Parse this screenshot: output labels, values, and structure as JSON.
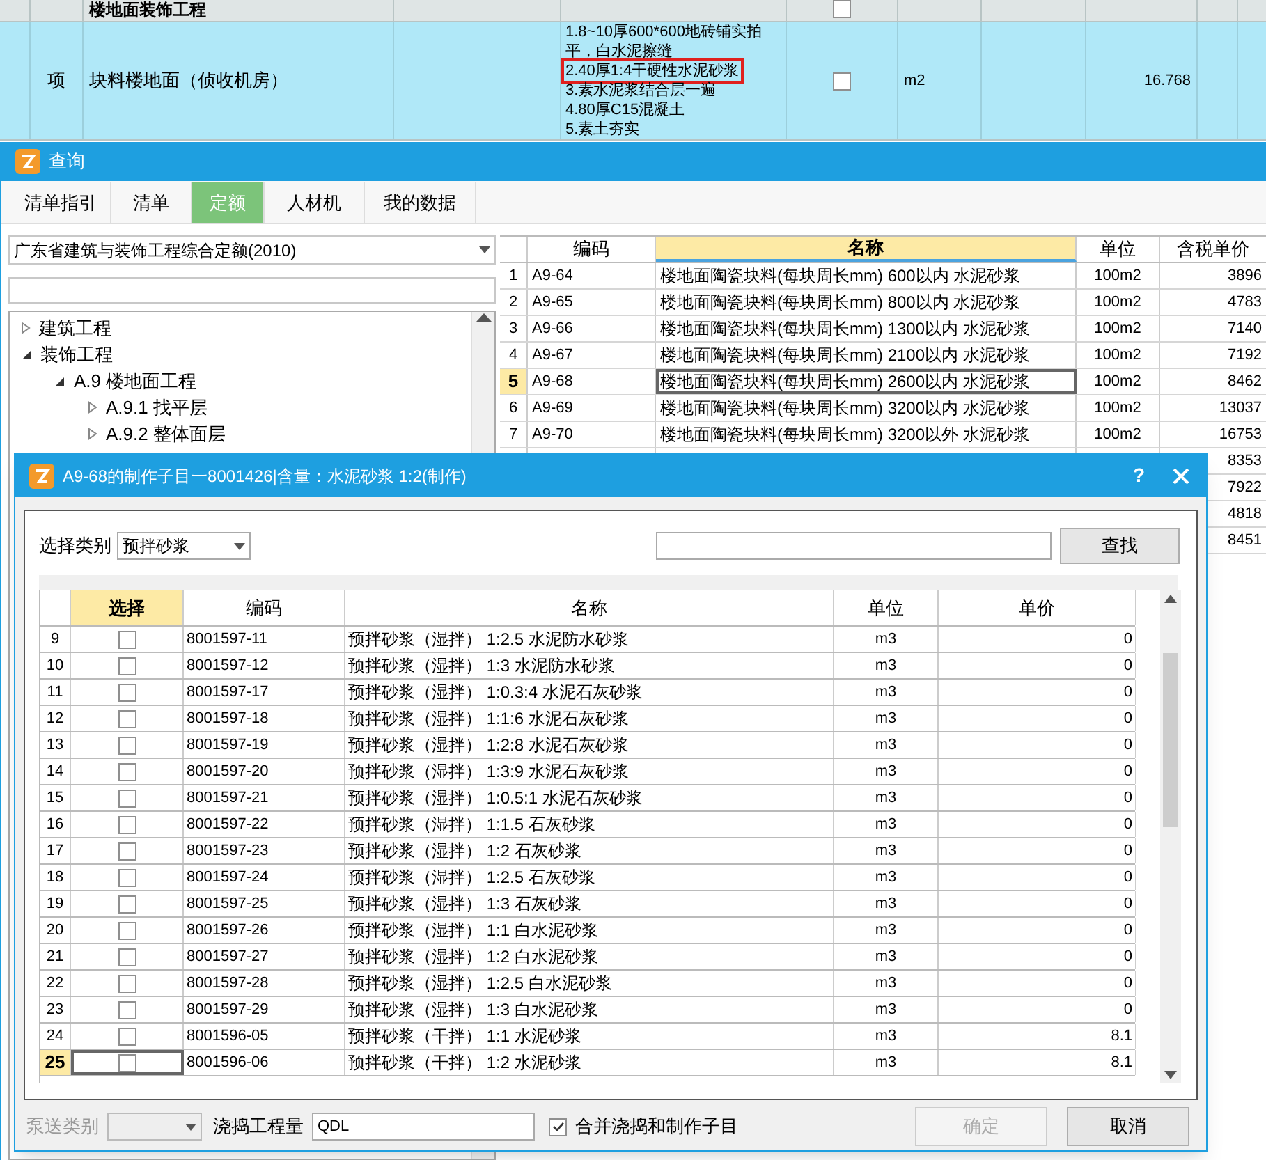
{
  "sheet": {
    "group_row": {
      "name": "楼地面装饰工程",
      "checked": false
    },
    "item_row": {
      "type": "项",
      "name": "块料楼地面（侦收机房）",
      "selected": true,
      "checked": false,
      "unit": "m2",
      "quantity": "16.768",
      "description_lines": [
        {
          "text": "1.8~10厚600*600地砖铺实拍",
          "highlighted": false
        },
        {
          "text": "平，白水泥擦缝",
          "highlighted": false
        },
        {
          "text": "2.40厚1:4干硬性水泥砂浆",
          "highlighted": true
        },
        {
          "text": "3.素水泥浆结合层一遍",
          "highlighted": false
        },
        {
          "text": "4.80厚C15混凝土",
          "highlighted": false
        },
        {
          "text": "5.素土夯实",
          "highlighted": false
        }
      ]
    }
  },
  "query_window": {
    "title": "查询",
    "tabs": [
      {
        "label": "清单指引",
        "selected": false
      },
      {
        "label": "清单",
        "selected": false
      },
      {
        "label": "定额",
        "selected": true
      },
      {
        "label": "人材机",
        "selected": false
      },
      {
        "label": "我的数据",
        "selected": false
      }
    ],
    "library_select": "广东省建筑与装饰工程综合定额(2010)",
    "tree": [
      {
        "label": "建筑工程",
        "expanded": false
      },
      {
        "label": "装饰工程",
        "expanded": true,
        "children": [
          {
            "label": "A.9 楼地面工程",
            "expanded": true,
            "children": [
              {
                "label": "A.9.1 找平层",
                "expanded": false
              },
              {
                "label": "A.9.2 整体面层",
                "expanded": false
              }
            ]
          }
        ]
      }
    ],
    "table": {
      "columns": [
        {
          "label": "编码",
          "selected": false
        },
        {
          "label": "名称",
          "selected": true
        },
        {
          "label": "单位",
          "selected": false
        },
        {
          "label": "含税单价",
          "selected": false
        }
      ],
      "rows": [
        {
          "index": "1",
          "code": "A9-64",
          "name": "楼地面陶瓷块料(每块周长mm) 600以内  水泥砂浆",
          "unit": "100m2",
          "price": "3896",
          "selected": false
        },
        {
          "index": "2",
          "code": "A9-65",
          "name": "楼地面陶瓷块料(每块周长mm) 800以内  水泥砂浆",
          "unit": "100m2",
          "price": "4783",
          "selected": false
        },
        {
          "index": "3",
          "code": "A9-66",
          "name": "楼地面陶瓷块料(每块周长mm) 1300以内  水泥砂浆",
          "unit": "100m2",
          "price": "7140",
          "selected": false
        },
        {
          "index": "4",
          "code": "A9-67",
          "name": "楼地面陶瓷块料(每块周长mm) 2100以内  水泥砂浆",
          "unit": "100m2",
          "price": "7192",
          "selected": false
        },
        {
          "index": "5",
          "code": "A9-68",
          "name": "楼地面陶瓷块料(每块周长mm) 2600以内  水泥砂浆",
          "unit": "100m2",
          "price": "8462",
          "selected": true
        },
        {
          "index": "6",
          "code": "A9-69",
          "name": "楼地面陶瓷块料(每块周长mm) 3200以内  水泥砂浆",
          "unit": "100m2",
          "price": "13037",
          "selected": false
        },
        {
          "index": "7",
          "code": "A9-70",
          "name": "楼地面陶瓷块料(每块周长mm) 3200以外  水泥砂浆",
          "unit": "100m2",
          "price": "16753",
          "selected": false
        },
        {
          "price": "8353"
        },
        {
          "price": "7922"
        },
        {
          "price": "4818"
        },
        {
          "price": "8451"
        }
      ]
    }
  },
  "dialog": {
    "title": "A9-68的制作子目一8001426|含量：水泥砂浆 1:2(制作)",
    "help_button": "?",
    "category": {
      "label": "选择类别",
      "value": "预拌砂浆"
    },
    "find_button": "查找",
    "table": {
      "columns": [
        {
          "label": "选择",
          "selected": true
        },
        {
          "label": "编码",
          "selected": false
        },
        {
          "label": "名称",
          "selected": false
        },
        {
          "label": "单位",
          "selected": false
        },
        {
          "label": "单价",
          "selected": false
        }
      ],
      "rows": [
        {
          "index": "9",
          "checked": false,
          "code": "8001597-11",
          "name": "预拌砂浆（湿拌） 1:2.5 水泥防水砂浆",
          "unit": "m3",
          "price": "0",
          "selected": false
        },
        {
          "index": "10",
          "checked": false,
          "code": "8001597-12",
          "name": "预拌砂浆（湿拌） 1:3 水泥防水砂浆",
          "unit": "m3",
          "price": "0",
          "selected": false
        },
        {
          "index": "11",
          "checked": false,
          "code": "8001597-17",
          "name": "预拌砂浆（湿拌） 1:0.3:4 水泥石灰砂浆",
          "unit": "m3",
          "price": "0",
          "selected": false
        },
        {
          "index": "12",
          "checked": false,
          "code": "8001597-18",
          "name": "预拌砂浆（湿拌） 1:1:6 水泥石灰砂浆",
          "unit": "m3",
          "price": "0",
          "selected": false
        },
        {
          "index": "13",
          "checked": false,
          "code": "8001597-19",
          "name": "预拌砂浆（湿拌） 1:2:8 水泥石灰砂浆",
          "unit": "m3",
          "price": "0",
          "selected": false
        },
        {
          "index": "14",
          "checked": false,
          "code": "8001597-20",
          "name": "预拌砂浆（湿拌） 1:3:9 水泥石灰砂浆",
          "unit": "m3",
          "price": "0",
          "selected": false
        },
        {
          "index": "15",
          "checked": false,
          "code": "8001597-21",
          "name": "预拌砂浆（湿拌） 1:0.5:1 水泥石灰砂浆",
          "unit": "m3",
          "price": "0",
          "selected": false
        },
        {
          "index": "16",
          "checked": false,
          "code": "8001597-22",
          "name": "预拌砂浆（湿拌） 1:1.5 石灰砂浆",
          "unit": "m3",
          "price": "0",
          "selected": false
        },
        {
          "index": "17",
          "checked": false,
          "code": "8001597-23",
          "name": "预拌砂浆（湿拌） 1:2 石灰砂浆",
          "unit": "m3",
          "price": "0",
          "selected": false
        },
        {
          "index": "18",
          "checked": false,
          "code": "8001597-24",
          "name": "预拌砂浆（湿拌） 1:2.5 石灰砂浆",
          "unit": "m3",
          "price": "0",
          "selected": false
        },
        {
          "index": "19",
          "checked": false,
          "code": "8001597-25",
          "name": "预拌砂浆（湿拌） 1:3 石灰砂浆",
          "unit": "m3",
          "price": "0",
          "selected": false
        },
        {
          "index": "20",
          "checked": false,
          "code": "8001597-26",
          "name": "预拌砂浆（湿拌） 1:1 白水泥砂浆",
          "unit": "m3",
          "price": "0",
          "selected": false
        },
        {
          "index": "21",
          "checked": false,
          "code": "8001597-27",
          "name": "预拌砂浆（湿拌） 1:2 白水泥砂浆",
          "unit": "m3",
          "price": "0",
          "selected": false
        },
        {
          "index": "22",
          "checked": false,
          "code": "8001597-28",
          "name": "预拌砂浆（湿拌） 1:2.5 白水泥砂浆",
          "unit": "m3",
          "price": "0",
          "selected": false
        },
        {
          "index": "23",
          "checked": false,
          "code": "8001597-29",
          "name": "预拌砂浆（湿拌） 1:3 白水泥砂浆",
          "unit": "m3",
          "price": "0",
          "selected": false
        },
        {
          "index": "24",
          "checked": false,
          "code": "8001596-05",
          "name": "预拌砂浆（干拌） 1:1 水泥砂浆",
          "unit": "m3",
          "price": "8.1",
          "selected": false
        },
        {
          "index": "25",
          "checked": false,
          "code": "8001596-06",
          "name": "预拌砂浆（干拌） 1:2 水泥砂浆",
          "unit": "m3",
          "price": "8.1",
          "selected": true
        }
      ]
    },
    "pump_type": {
      "label": "泵送类别",
      "disabled": true
    },
    "pour_quantity": {
      "label": "浇捣工程量",
      "value": "QDL"
    },
    "merge_option": {
      "label": "合并浇捣和制作子目",
      "checked": true
    },
    "buttons": [
      {
        "label": "确定",
        "disabled": true
      },
      {
        "label": "取消",
        "disabled": false
      }
    ]
  }
}
